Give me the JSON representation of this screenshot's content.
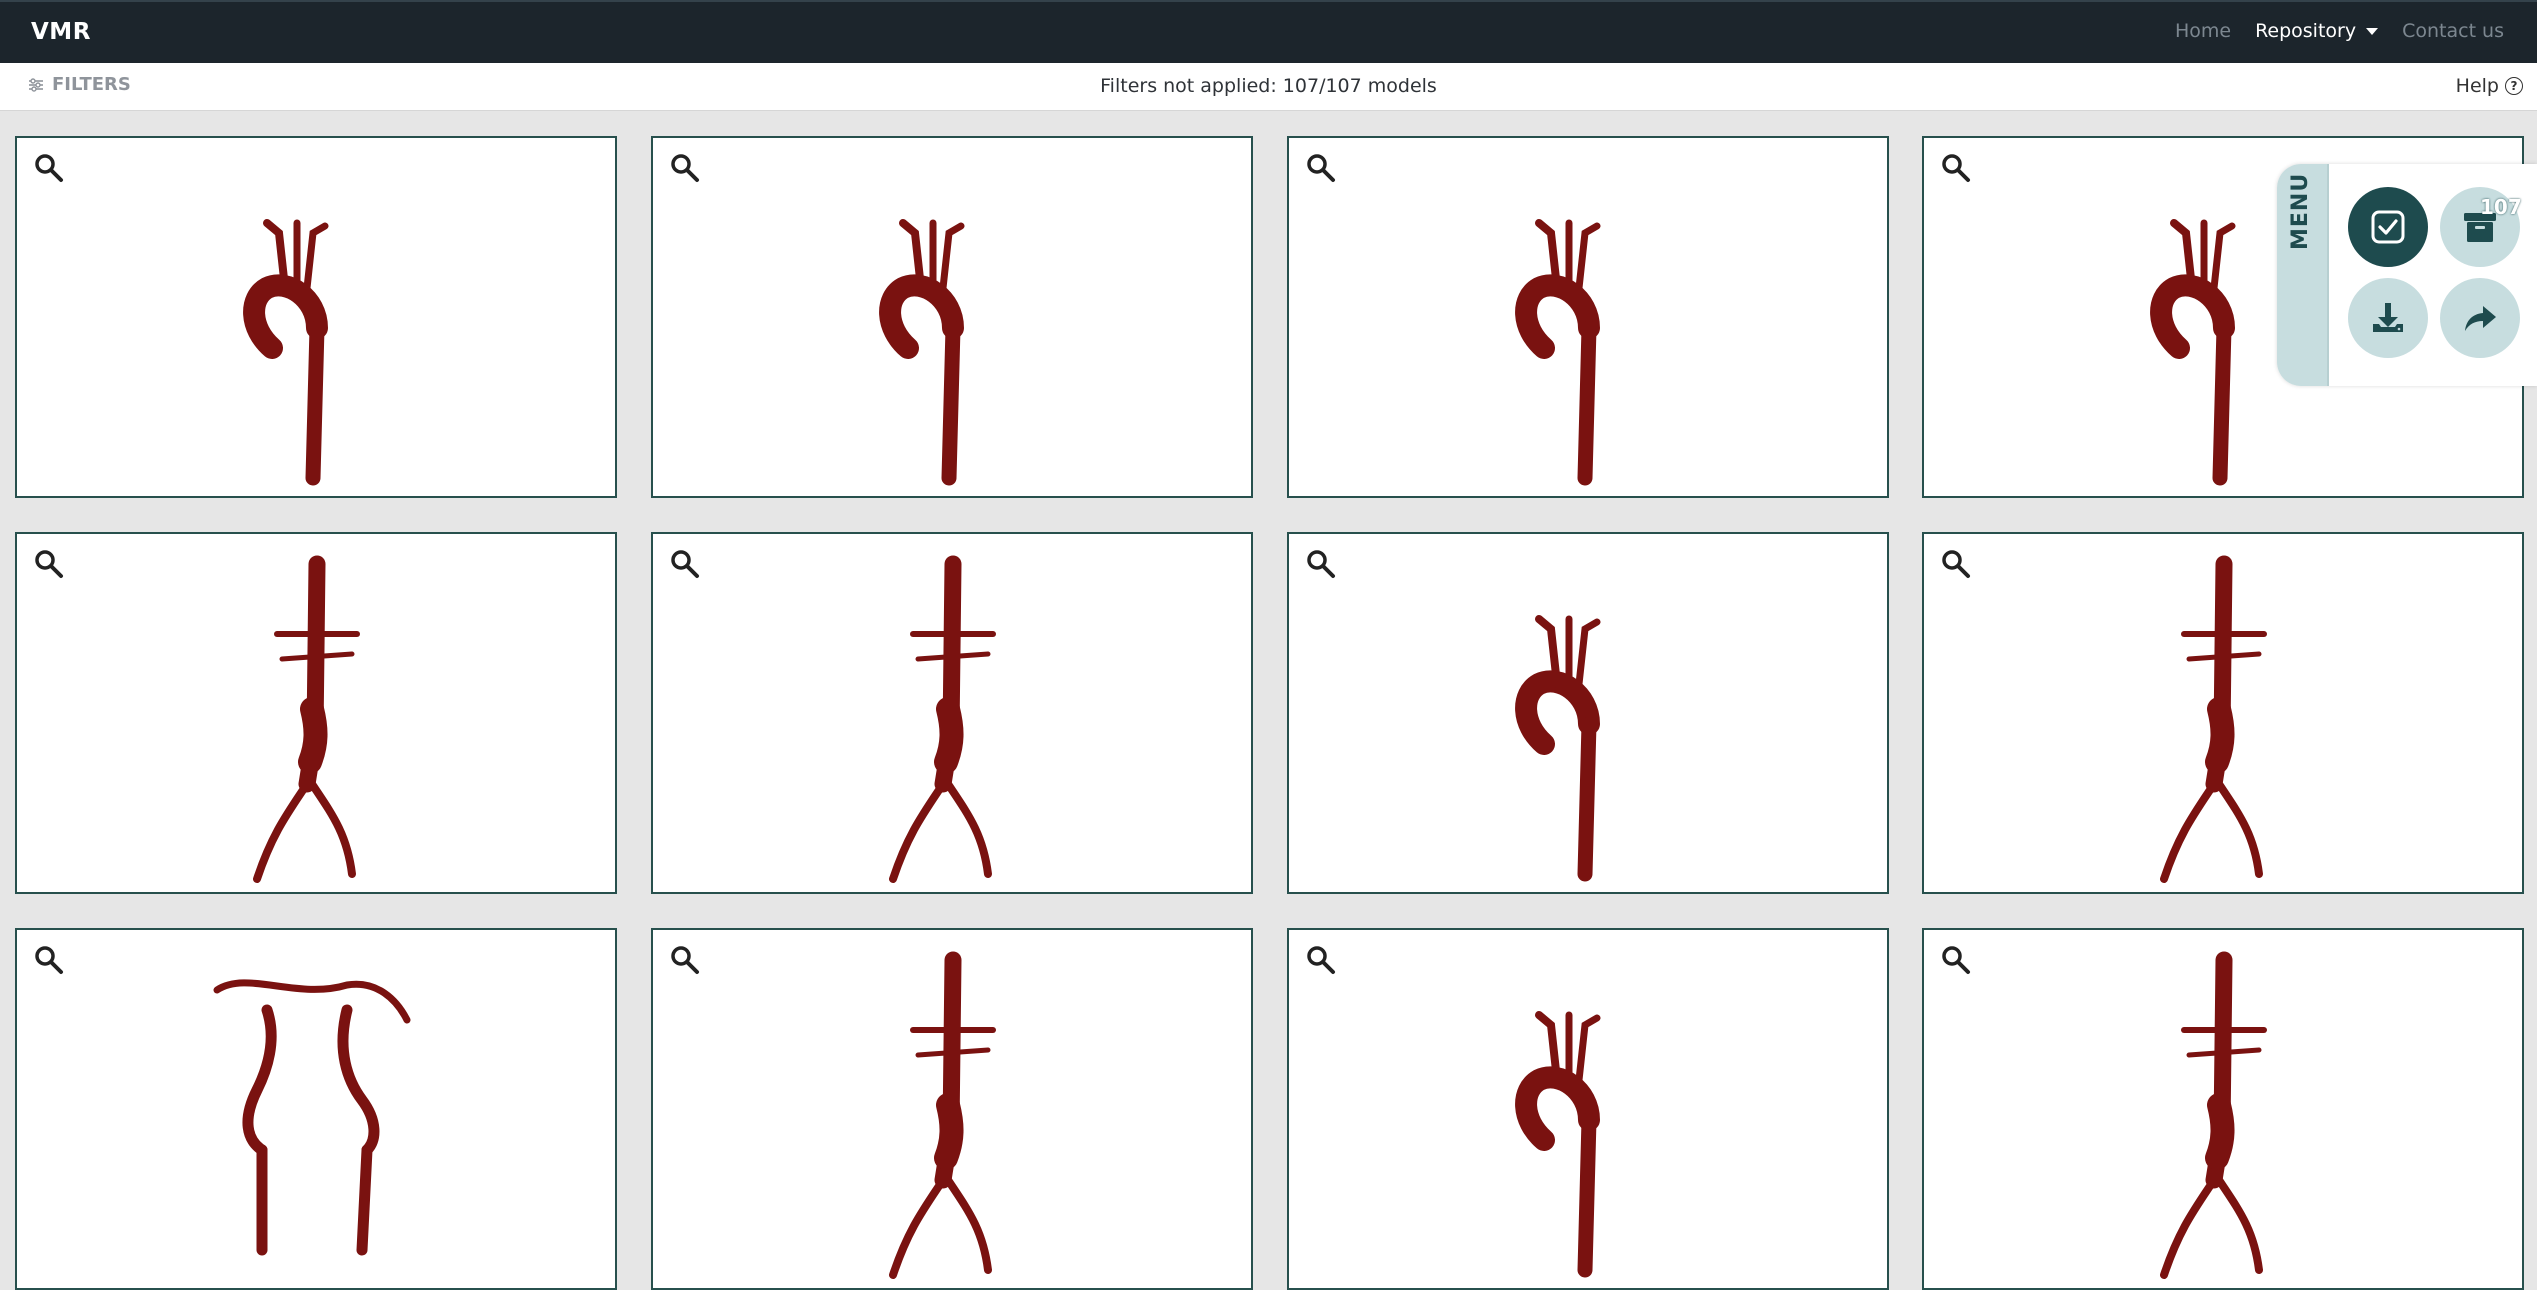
{
  "navbar": {
    "brand": "VMR",
    "links": {
      "home": "Home",
      "repository": "Repository",
      "contact": "Contact us"
    }
  },
  "filterbar": {
    "filters_label": "FILTERS",
    "status": "Filters not applied: 107/107 models",
    "help_label": "Help"
  },
  "menu": {
    "label": "MENU",
    "selection_count": "107"
  },
  "cards": [
    {
      "model": "aorta"
    },
    {
      "model": "aorta"
    },
    {
      "model": "aorta"
    },
    {
      "model": "aorta"
    },
    {
      "model": "abdominal"
    },
    {
      "model": "abdominal"
    },
    {
      "model": "aorta"
    },
    {
      "model": "abdominal"
    },
    {
      "model": "cerebral"
    },
    {
      "model": "abdominal"
    },
    {
      "model": "aorta"
    },
    {
      "model": "abdominal"
    }
  ],
  "colors": {
    "navbar": "#1c252c",
    "accent": "#1e4b4e",
    "vessel": "#7a1210",
    "card_border": "#27504d"
  }
}
